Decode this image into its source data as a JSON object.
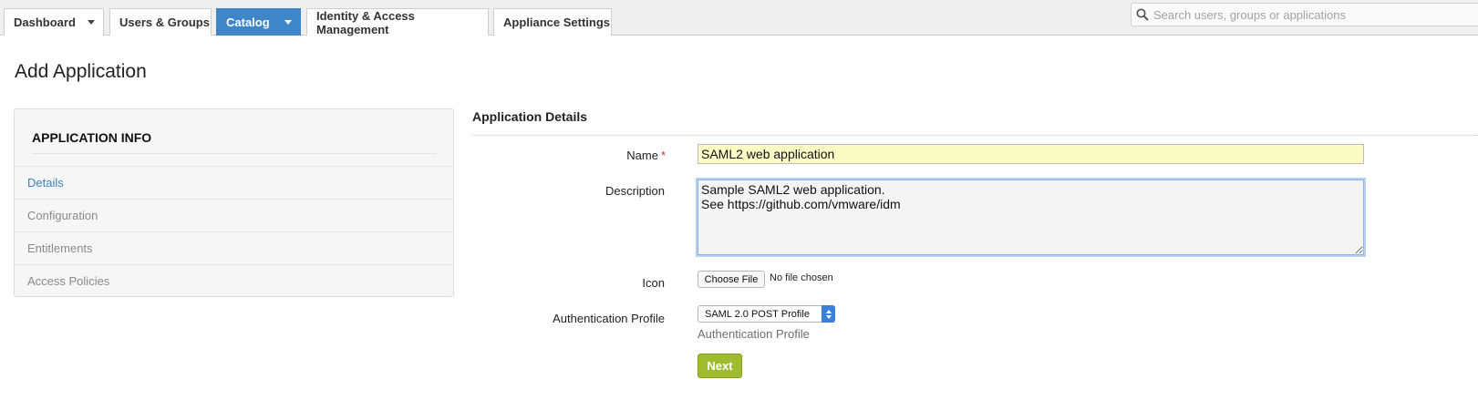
{
  "nav": {
    "tabs": [
      {
        "label": "Dashboard",
        "dropdown": true,
        "active": false
      },
      {
        "label": "Users & Groups",
        "dropdown": false,
        "active": false
      },
      {
        "label": "Catalog",
        "dropdown": true,
        "active": true
      },
      {
        "label": "Identity & Access Management",
        "dropdown": false,
        "active": false
      },
      {
        "label": "Appliance Settings",
        "dropdown": false,
        "active": false
      }
    ],
    "search": {
      "placeholder": "Search users, groups or applications",
      "value": "",
      "icon": "search-icon"
    }
  },
  "page": {
    "title": "Add Application"
  },
  "sidebar": {
    "header": "APPLICATION INFO",
    "items": [
      {
        "label": "Details",
        "active": true
      },
      {
        "label": "Configuration",
        "active": false
      },
      {
        "label": "Entitlements",
        "active": false
      },
      {
        "label": "Access Policies",
        "active": false
      }
    ]
  },
  "form": {
    "section_title": "Application Details",
    "name": {
      "label": "Name",
      "required_mark": "*",
      "value": "SAML2 web application"
    },
    "description": {
      "label": "Description",
      "value": "Sample SAML2 web application.\nSee https://github.com/vmware/idm"
    },
    "icon": {
      "label": "Icon",
      "button_label": "Choose File",
      "status": "No file chosen"
    },
    "auth_profile": {
      "label": "Authentication Profile",
      "selected": "SAML 2.0 POST Profile",
      "help": "Authentication Profile"
    },
    "next_label": "Next"
  },
  "colors": {
    "accent": "#3f86c9",
    "active_link": "#3f7fc0",
    "next_button": "#9fbb2e",
    "required_field_bg": "#fbfbc6",
    "required_mark": "#c0392b"
  }
}
